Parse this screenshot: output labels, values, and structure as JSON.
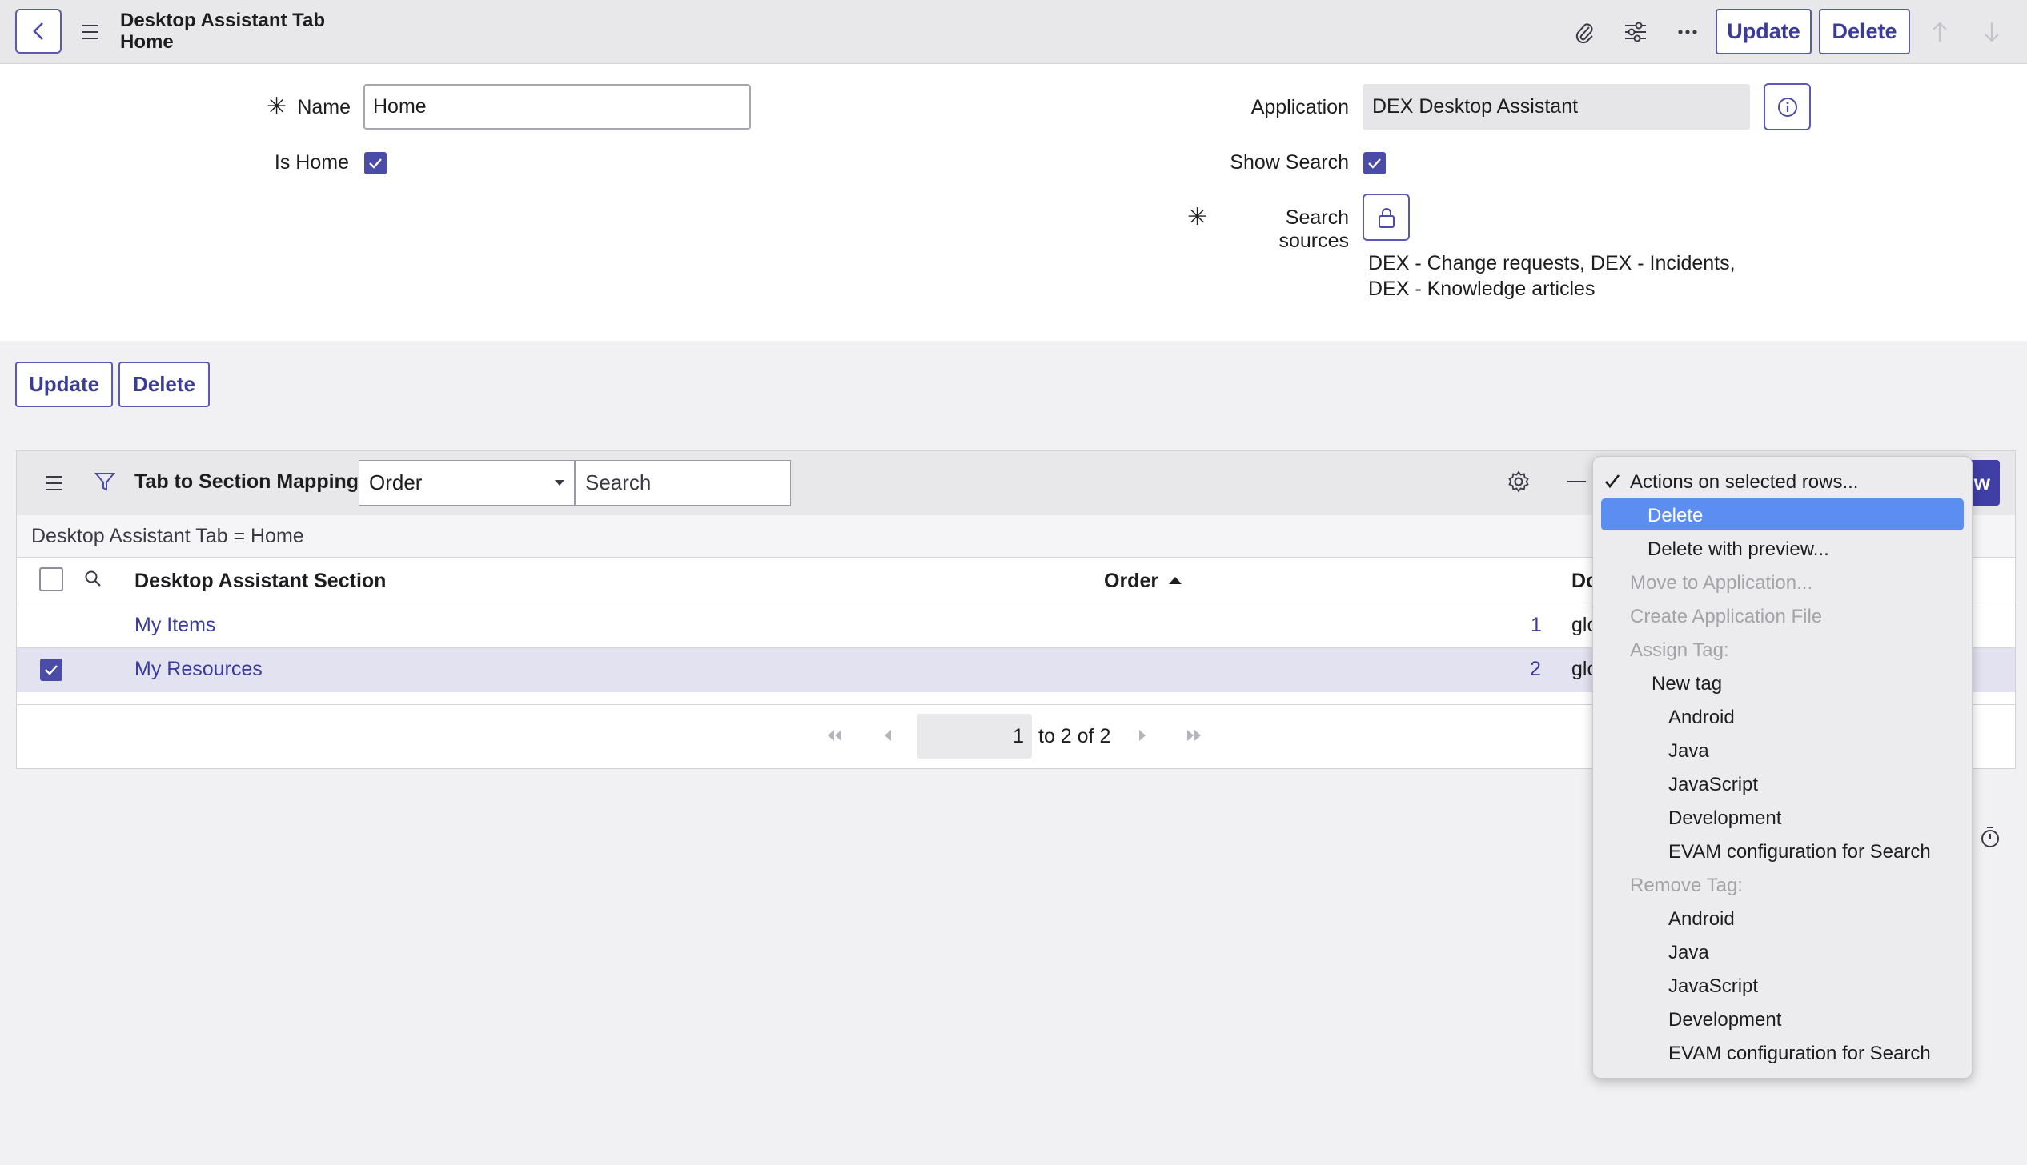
{
  "header": {
    "title_line1": "Desktop Assistant Tab",
    "title_line2": "Home",
    "update_label": "Update",
    "delete_label": "Delete"
  },
  "form": {
    "name_label": "Name",
    "name_value": "Home",
    "is_home_label": "Is Home",
    "is_home_checked": true,
    "application_label": "Application",
    "application_value": "DEX Desktop Assistant",
    "show_search_label": "Show Search",
    "show_search_checked": true,
    "search_sources_label": "Search sources",
    "search_sources_line1": "DEX - Change requests, DEX - Incidents,",
    "search_sources_line2": "DEX - Knowledge articles"
  },
  "form_buttons": {
    "update_label": "Update",
    "delete_label": "Delete"
  },
  "related_list": {
    "title": "Tab to Section Mappings",
    "field_select": "Order",
    "search_placeholder": "Search",
    "filter_breadcrumb": "Desktop Assistant Tab = Home",
    "columns": {
      "section": "Desktop Assistant Section",
      "order": "Order",
      "domain_partial": "Do"
    },
    "rows": [
      {
        "section": "My Items",
        "order": "1",
        "domain_partial": "glo",
        "selected": false
      },
      {
        "section": "My Resources",
        "order": "2",
        "domain_partial": "glo",
        "selected": true
      }
    ],
    "new_button_partial": "w",
    "pagination": {
      "page": "1",
      "range": "to 2 of 2"
    }
  },
  "actions_menu": {
    "header": "Actions on selected rows...",
    "items": [
      {
        "label": "Delete",
        "state": "highlighted"
      },
      {
        "label": "Delete with preview...",
        "state": "enabled"
      },
      {
        "label": "Move to Application...",
        "state": "disabled"
      },
      {
        "label": "Create Application File",
        "state": "disabled"
      },
      {
        "label": "Assign Tag:",
        "state": "disabled"
      },
      {
        "label": "New tag",
        "state": "enabled"
      },
      {
        "label": "Android",
        "state": "enabled"
      },
      {
        "label": "Java",
        "state": "enabled"
      },
      {
        "label": "JavaScript",
        "state": "enabled"
      },
      {
        "label": "Development",
        "state": "enabled"
      },
      {
        "label": "EVAM configuration for Search",
        "state": "enabled"
      },
      {
        "label": "Remove Tag:",
        "state": "disabled"
      },
      {
        "label": "Android",
        "state": "enabled"
      },
      {
        "label": "Java",
        "state": "enabled"
      },
      {
        "label": "JavaScript",
        "state": "enabled"
      },
      {
        "label": "Development",
        "state": "enabled"
      },
      {
        "label": "EVAM configuration for Search",
        "state": "enabled"
      }
    ]
  },
  "colors": {
    "accent": "#4b4ba8",
    "highlight": "#5b8ef0",
    "link": "#3b3b9a"
  }
}
